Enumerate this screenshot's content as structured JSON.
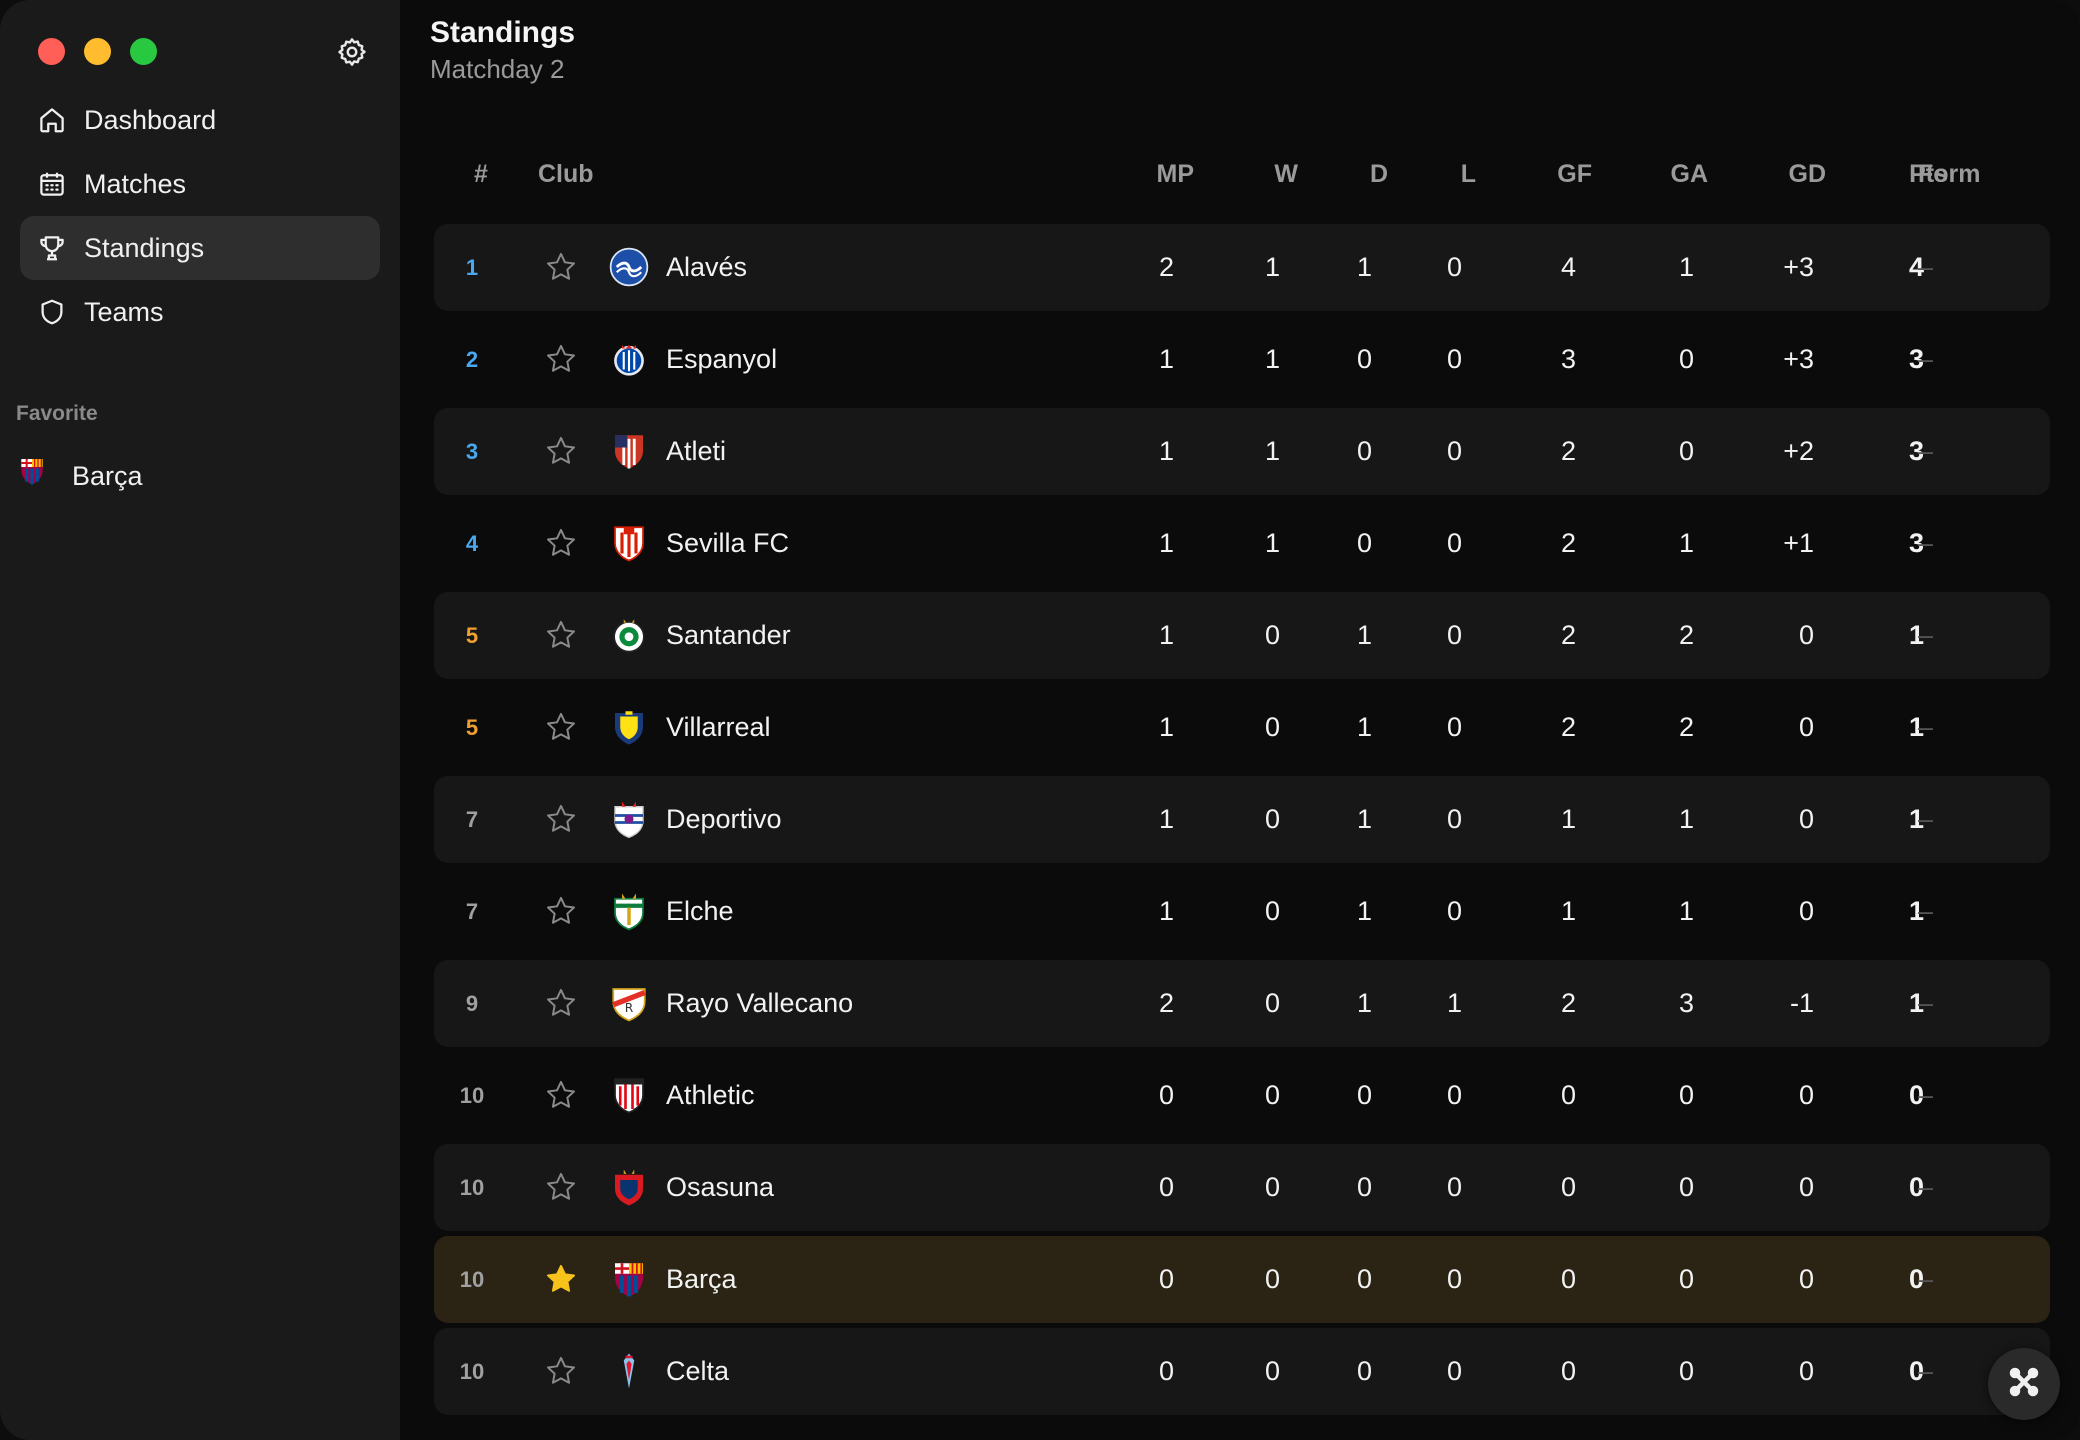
{
  "sidebar": {
    "nav": [
      {
        "label": "Dashboard",
        "icon": "home-icon"
      },
      {
        "label": "Matches",
        "icon": "calendar-icon"
      },
      {
        "label": "Standings",
        "icon": "trophy-icon",
        "active": true
      },
      {
        "label": "Teams",
        "icon": "shield-icon"
      }
    ],
    "favorites_heading": "Favorite",
    "favorites": [
      {
        "label": "Barça"
      }
    ]
  },
  "header": {
    "title": "Standings",
    "subtitle": "Matchday 2"
  },
  "table": {
    "columns": {
      "rank": "#",
      "club": "Club",
      "mp": "MP",
      "w": "W",
      "d": "D",
      "l": "L",
      "gf": "GF",
      "ga": "GA",
      "gd": "GD",
      "pts": "Pts",
      "form": "Form"
    },
    "rows": [
      {
        "rank": "1",
        "club": "Alavés",
        "mp": "2",
        "w": "1",
        "d": "1",
        "l": "0",
        "gf": "4",
        "ga": "1",
        "gd": "+3",
        "pts": "4",
        "form": "–",
        "favorite": false,
        "rank_color": "#4aa8f0"
      },
      {
        "rank": "2",
        "club": "Espanyol",
        "mp": "1",
        "w": "1",
        "d": "0",
        "l": "0",
        "gf": "3",
        "ga": "0",
        "gd": "+3",
        "pts": "3",
        "form": "–",
        "favorite": false,
        "rank_color": "#4aa8f0"
      },
      {
        "rank": "3",
        "club": "Atleti",
        "mp": "1",
        "w": "1",
        "d": "0",
        "l": "0",
        "gf": "2",
        "ga": "0",
        "gd": "+2",
        "pts": "3",
        "form": "–",
        "favorite": false,
        "rank_color": "#4aa8f0"
      },
      {
        "rank": "4",
        "club": "Sevilla FC",
        "mp": "1",
        "w": "1",
        "d": "0",
        "l": "0",
        "gf": "2",
        "ga": "1",
        "gd": "+1",
        "pts": "3",
        "form": "–",
        "favorite": false,
        "rank_color": "#4aa8f0"
      },
      {
        "rank": "5",
        "club": "Santander",
        "mp": "1",
        "w": "0",
        "d": "1",
        "l": "0",
        "gf": "2",
        "ga": "2",
        "gd": "0",
        "pts": "1",
        "form": "–",
        "favorite": false,
        "rank_color": "#f0a030"
      },
      {
        "rank": "5",
        "club": "Villarreal",
        "mp": "1",
        "w": "0",
        "d": "1",
        "l": "0",
        "gf": "2",
        "ga": "2",
        "gd": "0",
        "pts": "1",
        "form": "–",
        "favorite": false,
        "rank_color": "#f0a030"
      },
      {
        "rank": "7",
        "club": "Deportivo",
        "mp": "1",
        "w": "0",
        "d": "1",
        "l": "0",
        "gf": "1",
        "ga": "1",
        "gd": "0",
        "pts": "1",
        "form": "–",
        "favorite": false,
        "rank_color": "#a0a0a0"
      },
      {
        "rank": "7",
        "club": "Elche",
        "mp": "1",
        "w": "0",
        "d": "1",
        "l": "0",
        "gf": "1",
        "ga": "1",
        "gd": "0",
        "pts": "1",
        "form": "–",
        "favorite": false,
        "rank_color": "#a0a0a0"
      },
      {
        "rank": "9",
        "club": "Rayo Vallecano",
        "mp": "2",
        "w": "0",
        "d": "1",
        "l": "1",
        "gf": "2",
        "ga": "3",
        "gd": "-1",
        "pts": "1",
        "form": "–",
        "favorite": false,
        "rank_color": "#a0a0a0"
      },
      {
        "rank": "10",
        "club": "Athletic",
        "mp": "0",
        "w": "0",
        "d": "0",
        "l": "0",
        "gf": "0",
        "ga": "0",
        "gd": "0",
        "pts": "0",
        "form": "–",
        "favorite": false,
        "rank_color": "#a0a0a0"
      },
      {
        "rank": "10",
        "club": "Osasuna",
        "mp": "0",
        "w": "0",
        "d": "0",
        "l": "0",
        "gf": "0",
        "ga": "0",
        "gd": "0",
        "pts": "0",
        "form": "–",
        "favorite": false,
        "rank_color": "#a0a0a0"
      },
      {
        "rank": "10",
        "club": "Barça",
        "mp": "0",
        "w": "0",
        "d": "0",
        "l": "0",
        "gf": "0",
        "ga": "0",
        "gd": "0",
        "pts": "0",
        "form": "–",
        "favorite": true,
        "rank_color": "#a0a0a0"
      },
      {
        "rank": "10",
        "club": "Celta",
        "mp": "0",
        "w": "0",
        "d": "0",
        "l": "0",
        "gf": "0",
        "ga": "0",
        "gd": "0",
        "pts": "0",
        "form": "–",
        "favorite": false,
        "rank_color": "#a0a0a0"
      }
    ]
  },
  "colors": {
    "favorite_star": "#f7c21a",
    "highlight_row": "#2b2414"
  }
}
